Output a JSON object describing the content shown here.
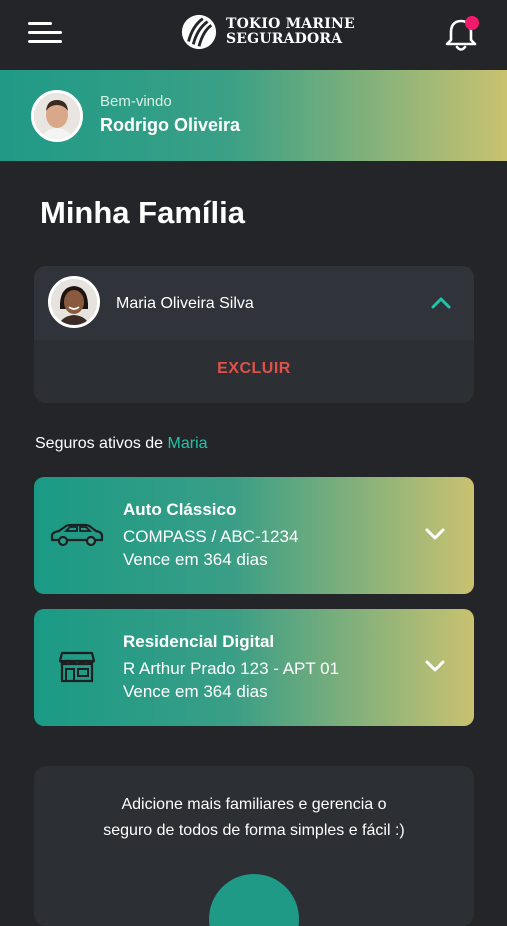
{
  "header": {
    "logo_line1": "TOKIO MARINE",
    "logo_line2": "SEGURADORA",
    "icons": {
      "menu": "hamburger-menu-icon",
      "notifications": "bell-icon"
    },
    "notification_dot_color": "#f21a6a"
  },
  "welcome": {
    "greeting": "Bem-vindo",
    "user_name": "Rodrigo Oliveira"
  },
  "page": {
    "title": "Minha Família"
  },
  "member": {
    "name": "Maria Oliveira Silva",
    "delete_label": "EXCLUIR"
  },
  "active_insurance": {
    "label_prefix": "Seguros ativos de ",
    "label_name": "Maria",
    "policies": [
      {
        "icon": "car-icon",
        "title": "Auto Clássico",
        "line1": "COMPASS / ABC-1234",
        "line2": "Vence em 364 dias"
      },
      {
        "icon": "house-icon",
        "title": "Residencial Digital",
        "line1": "R Arthur Prado 123 - APT 01",
        "line2": "Vence em 364 dias"
      }
    ]
  },
  "promo": {
    "line1": "Adicione mais familiares e gerencia o",
    "line2": "seguro de todos de forma simples e fácil :)"
  },
  "colors": {
    "background": "#232529",
    "card": "#2c2f34",
    "accent_teal": "#1fc5a8",
    "gradient_start": "#1a9a85",
    "gradient_end": "#c9c270",
    "danger": "#e25048"
  }
}
